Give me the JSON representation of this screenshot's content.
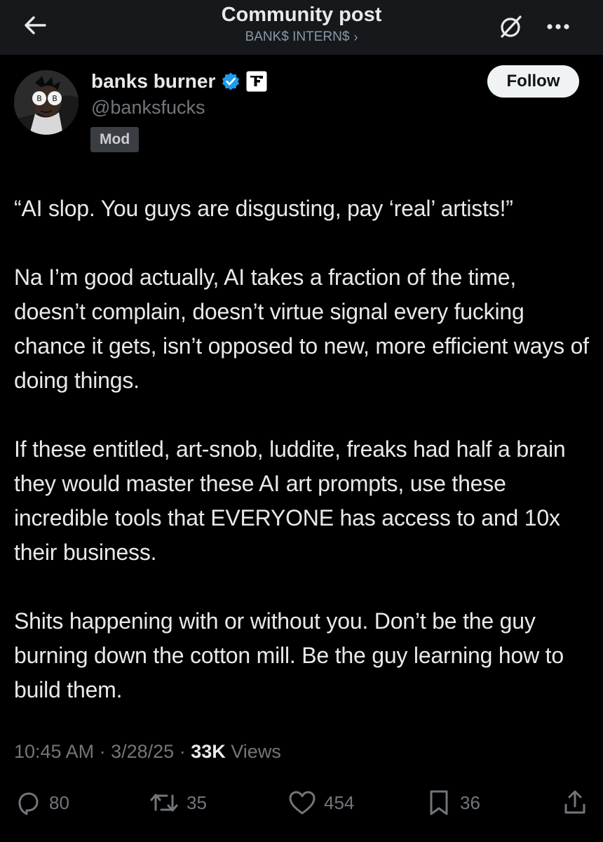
{
  "header": {
    "title": "Community post",
    "community_name": "BANK$ INTERN$",
    "community_chevron": "›"
  },
  "post": {
    "author": {
      "display_name": "banks burner",
      "handle": "@banksfucks",
      "role_badge": "Mod"
    },
    "follow_label": "Follow",
    "paragraphs": [
      "“AI slop. You guys are disgusting, pay ‘real’ artists!”",
      "Na I’m good actually, AI takes a fraction of the time, doesn’t complain, doesn’t virtue signal every fucking chance it gets, isn’t opposed to new, more efficient ways of doing things.",
      "If these entitled, art-snob, luddite, freaks had half a brain they would master these AI art prompts, use these incredible tools that EVERYONE has access to and 10x their business.",
      "Shits happening with or without you. Don’t be the guy burning down the cotton mill. Be the guy learning how to build them."
    ],
    "time": "10:45 AM",
    "separator": "·",
    "date": "3/28/25",
    "views_count": "33K",
    "views_label": "Views"
  },
  "actions": {
    "replies": "80",
    "reposts": "35",
    "likes": "454",
    "bookmarks": "36"
  },
  "icons": {
    "back": "arrow-left-icon",
    "hide": "hide-icon",
    "more": "more-horizontal-icon",
    "verified": "verified-badge-icon",
    "affiliate": "affiliate-logo-icon",
    "reply": "reply-icon",
    "repost": "repost-icon",
    "like": "heart-icon",
    "bookmark": "bookmark-icon",
    "share": "share-icon"
  },
  "colors": {
    "background": "#000000",
    "header_background": "#16181c",
    "text_primary": "#e7e9ea",
    "text_secondary": "#71767b",
    "verified_blue": "#1d9bf0",
    "mod_badge_bg": "#3a3d41"
  }
}
